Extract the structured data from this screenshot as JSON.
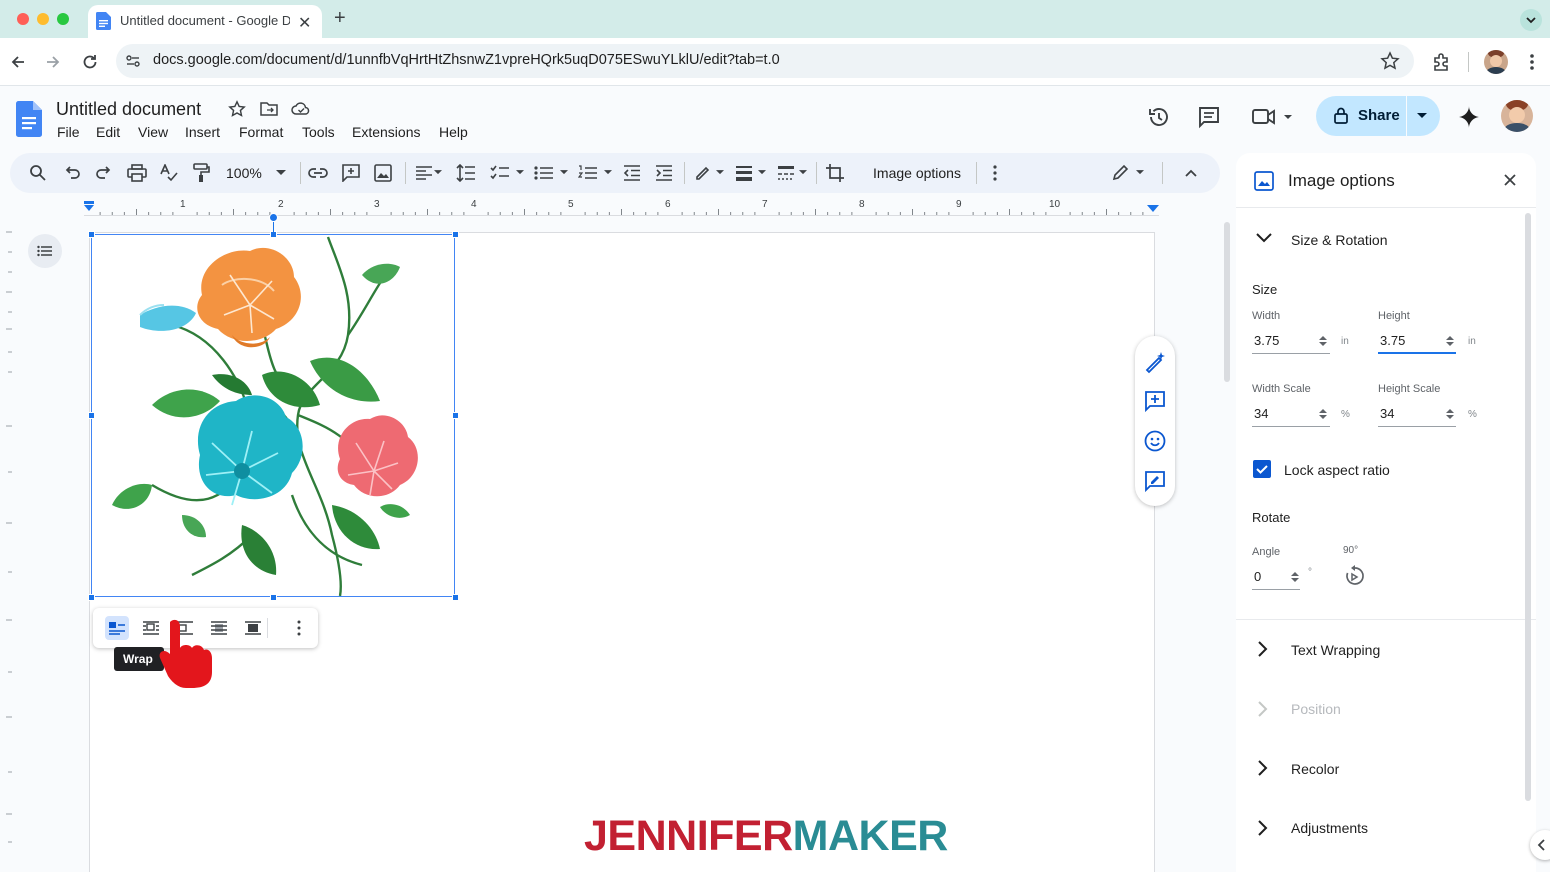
{
  "browser": {
    "tab_title": "Untitled document - Google Docs",
    "url": "docs.google.com/document/d/1unnfbVqHrtHtZhsnwZ1vpreHQrk5uqD075ESwuYLklU/edit?tab=t.0",
    "new_tab_label": "+"
  },
  "docs": {
    "title": "Untitled document",
    "menu": [
      "File",
      "Edit",
      "View",
      "Insert",
      "Format",
      "Tools",
      "Extensions",
      "Help"
    ],
    "share_label": "Share"
  },
  "toolbar": {
    "zoom": "100%",
    "image_options_label": "Image options"
  },
  "ruler": {
    "numbers": [
      "1",
      "2",
      "3",
      "4",
      "5",
      "6",
      "7",
      "8",
      "9",
      "10"
    ]
  },
  "image_toolbar": {
    "tooltip": "Wrap"
  },
  "panel": {
    "title": "Image options",
    "size_rotation": {
      "title": "Size & Rotation",
      "size_label": "Size",
      "width_label": "Width",
      "width_value": "3.75",
      "width_unit": "in",
      "height_label": "Height",
      "height_value": "3.75",
      "height_unit": "in",
      "width_scale_label": "Width Scale",
      "width_scale_value": "34",
      "width_scale_unit": "%",
      "height_scale_label": "Height Scale",
      "height_scale_value": "34",
      "height_scale_unit": "%",
      "lock_label": "Lock aspect ratio",
      "lock_checked": true,
      "rotate_label": "Rotate",
      "angle_label": "Angle",
      "angle_value": "0",
      "angle_unit": "°",
      "rotate90_label": "90°"
    },
    "sections": {
      "text_wrapping": "Text Wrapping",
      "position": "Position",
      "recolor": "Recolor",
      "adjustments": "Adjustments"
    }
  },
  "watermark": {
    "part1": "JENNIFER",
    "part2": "MAKER",
    "color1": "#c22032",
    "color2": "#2a8c94"
  },
  "colors": {
    "accent": "#1a73e8",
    "share_bg": "#c2e7ff",
    "tabstrip": "#d3ece9"
  }
}
